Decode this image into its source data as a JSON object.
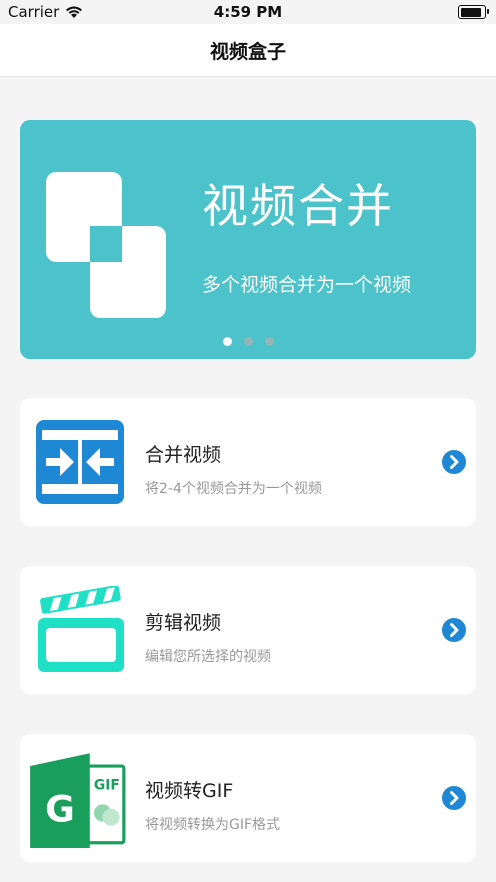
{
  "status": {
    "carrier": "Carrier",
    "time": "4:59 PM"
  },
  "nav": {
    "title": "视频盒子"
  },
  "banner": {
    "title": "视频合并",
    "subtitle": "多个视频合并为一个视频",
    "active_page": 1,
    "page_count": 3,
    "bg_color": "#4cc3ca"
  },
  "cards": [
    {
      "title": "合并视频",
      "subtitle": "将2-4个视频合并为一个视频",
      "icon": "merge-video-icon"
    },
    {
      "title": "剪辑视频",
      "subtitle": "编辑您所选择的视频",
      "icon": "clapperboard-icon"
    },
    {
      "title": "视频转GIF",
      "subtitle": "将视频转换为GIF格式",
      "icon": "gif-convert-icon",
      "icon_text": "GIF",
      "icon_letter": "G"
    }
  ],
  "colors": {
    "accent_blue": "#1e88d4",
    "accent_teal": "#1fe0c4",
    "gif_green": "#1a9e5c"
  }
}
